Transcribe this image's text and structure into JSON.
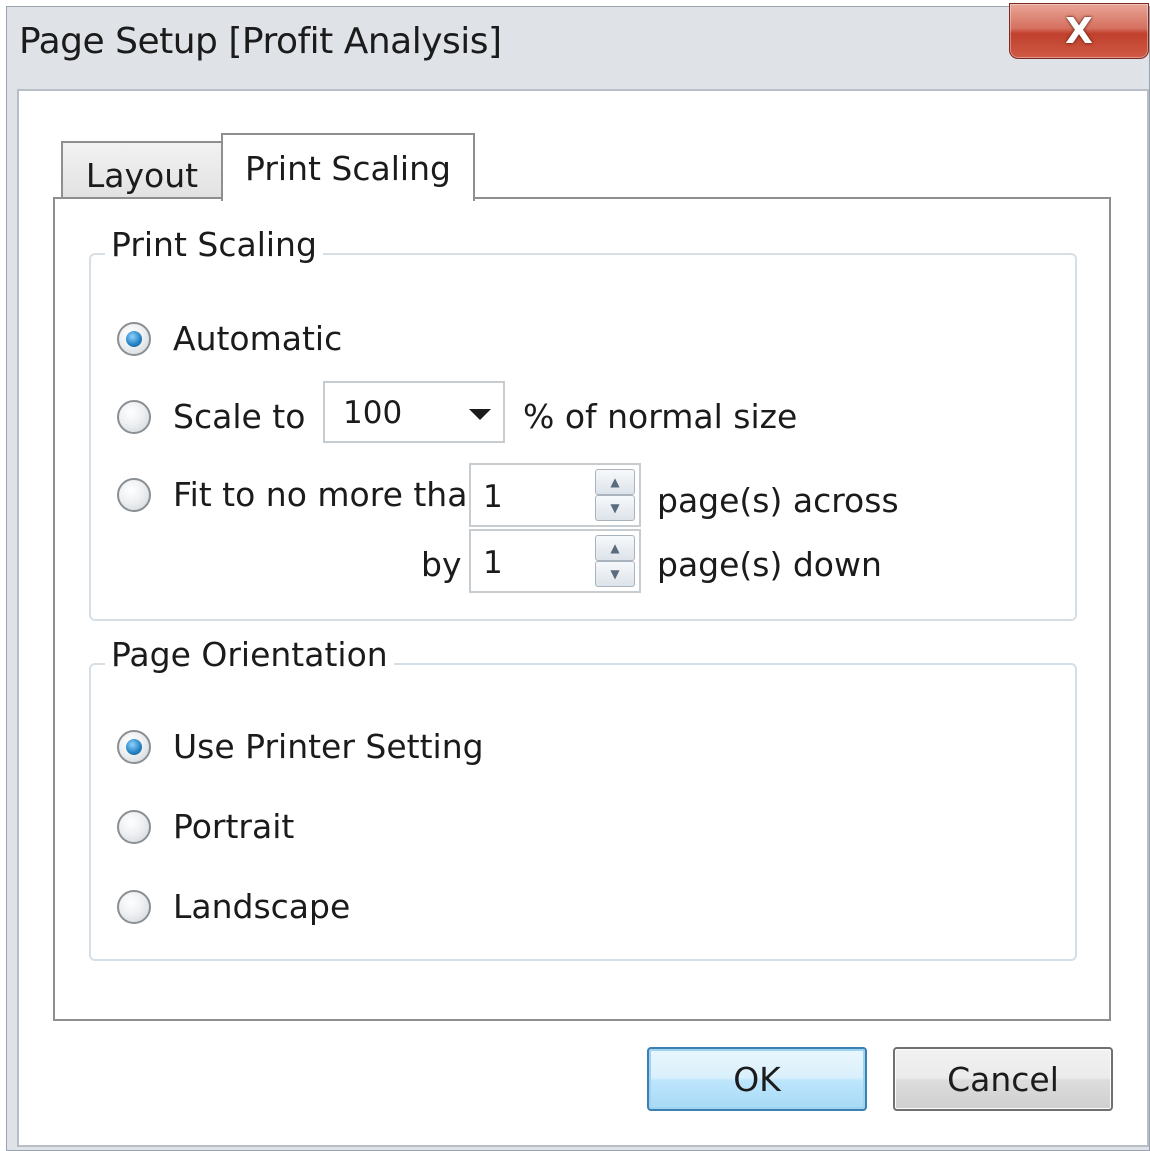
{
  "window": {
    "title": "Page Setup [Profit Analysis]",
    "close_glyph": "X"
  },
  "tabs": [
    {
      "label": "Layout",
      "selected": false
    },
    {
      "label": "Print Scaling",
      "selected": true
    }
  ],
  "print_scaling": {
    "legend": "Print Scaling",
    "automatic_label": "Automatic",
    "scale_to_label": "Scale to",
    "scale_value": "100",
    "scale_suffix": "% of normal size",
    "fit_label": "Fit to no more than",
    "across_value": "1",
    "across_suffix": "page(s) across",
    "by_label": "by",
    "down_value": "1",
    "down_suffix": "page(s) down",
    "selected": "Automatic"
  },
  "page_orientation": {
    "legend": "Page Orientation",
    "options": [
      "Use Printer Setting",
      "Portrait",
      "Landscape"
    ],
    "selected": "Use Printer Setting"
  },
  "buttons": {
    "ok": "OK",
    "cancel": "Cancel"
  },
  "icons": {
    "close": "close-icon",
    "dropdown": "chevron-down-icon",
    "spin_up": "arrow-up-icon",
    "spin_down": "arrow-down-icon"
  },
  "colors": {
    "close_button": "#c0402c",
    "radio_selected": "#2a86c6",
    "ok_border": "#3c7fb1"
  }
}
